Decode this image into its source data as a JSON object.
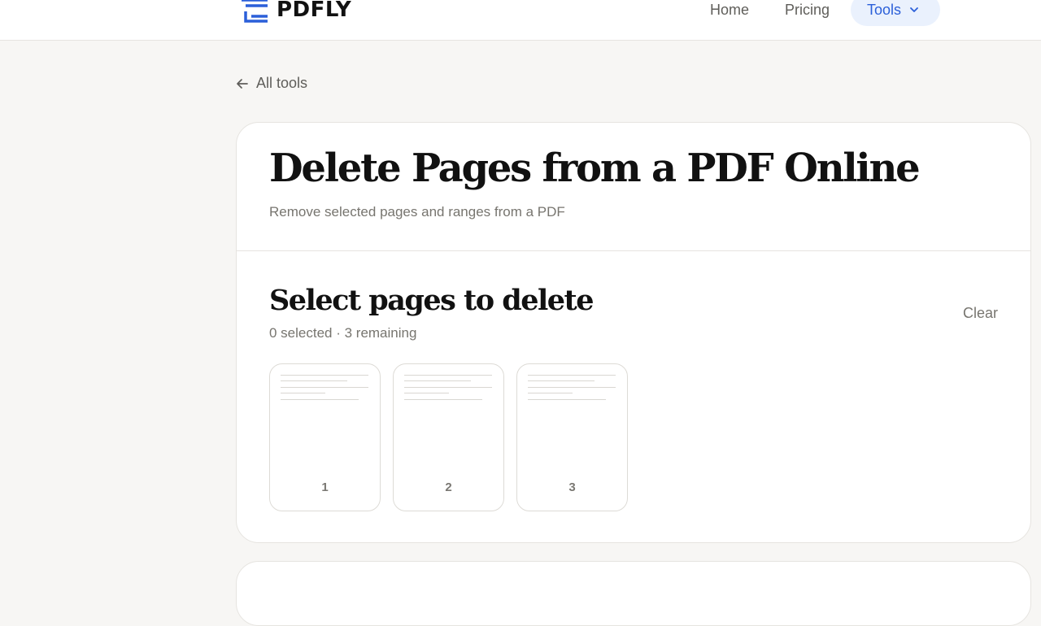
{
  "header": {
    "logo_text": "PDFLY",
    "nav": {
      "home": "Home",
      "pricing": "Pricing",
      "tools": "Tools"
    }
  },
  "back_link": "All tools",
  "tool": {
    "title": "Delete Pages from a PDF Online",
    "subtitle": "Remove selected pages and ranges from a PDF"
  },
  "selection": {
    "title": "Select pages to delete",
    "status": "0 selected · 3 remaining",
    "clear_label": "Clear",
    "pages": [
      {
        "number": "1"
      },
      {
        "number": "2"
      },
      {
        "number": "3"
      }
    ]
  },
  "colors": {
    "accent": "#2b5fd9",
    "accent_bg": "#eaf1fd",
    "page_bg": "#f7f6f4",
    "card_bg": "#ffffff",
    "muted_text": "#77756f"
  },
  "icons": {
    "logo": "stacked-tray-logo-icon",
    "tools_dropdown": "chevron-down-icon",
    "back": "arrow-left-icon"
  }
}
